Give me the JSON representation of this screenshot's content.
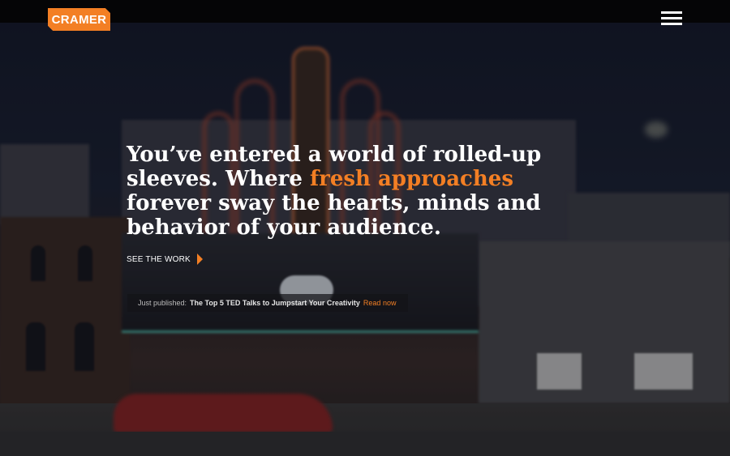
{
  "brand": {
    "logo_text": "CRAMER",
    "accent": "#f37f24"
  },
  "header": {
    "menu_icon": "hamburger-menu-icon"
  },
  "hero": {
    "headline_part1": "You’ve entered a world of rolled-up sleeves. Where ",
    "headline_highlight": "fresh approaches",
    "headline_part2": " forever sway the hearts, minds and behavior of your audience.",
    "cta_label": "SEE THE WORK",
    "cta_icon": "play-arrow-icon"
  },
  "publication": {
    "label": "Just published:",
    "title": "The Top 5 TED Talks to Jumpstart Your Creativity",
    "link": "Read now"
  }
}
